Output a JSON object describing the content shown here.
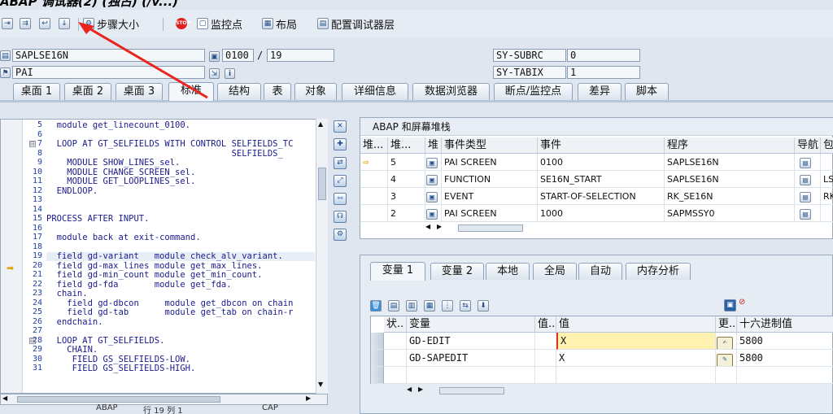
{
  "window": {
    "title": "ABAP 调试器(2) (独占) (/v...) "
  },
  "toolbar": {
    "step_size_label": "步骤大小",
    "breakpoints_label": "监控点",
    "layout_label": "布局",
    "config_label": "配置调试器层"
  },
  "info": {
    "program": "SAPLSE16N",
    "screen": "0100",
    "line": "19",
    "event": "PAI",
    "sy_subrc_label": "SY-SUBRC",
    "sy_subrc_value": "0",
    "sy_tabix_label": "SY-TABIX",
    "sy_tabix_value": "1"
  },
  "tabs": [
    "桌面 1",
    "桌面 2",
    "桌面 3",
    "标准",
    "结构",
    "表",
    "对象",
    "详细信息",
    "数据浏览器",
    "断点/监控点",
    "差异",
    "脚本"
  ],
  "editor": {
    "lines": [
      {
        "n": "5",
        "t": "  module get_linecount_0100."
      },
      {
        "n": "6",
        "t": ""
      },
      {
        "n": "7",
        "t": "  LOOP AT GT_SELFIELDS WITH CONTROL SELFIELDS_TC"
      },
      {
        "n": "8",
        "t": "                                    SELFIELDS_"
      },
      {
        "n": "9",
        "t": "    MODULE SHOW_LINES_sel."
      },
      {
        "n": "10",
        "t": "    MODULE CHANGE_SCREEN_sel."
      },
      {
        "n": "11",
        "t": "    MODULE GET_LOOPLINES_sel."
      },
      {
        "n": "12",
        "t": "  ENDLOOP."
      },
      {
        "n": "13",
        "t": ""
      },
      {
        "n": "14",
        "t": ""
      },
      {
        "n": "15",
        "t": "PROCESS AFTER INPUT."
      },
      {
        "n": "16",
        "t": ""
      },
      {
        "n": "17",
        "t": "  module back at exit-command."
      },
      {
        "n": "18",
        "t": ""
      },
      {
        "n": "19",
        "t": "  field gd-variant   module check_alv_variant."
      },
      {
        "n": "20",
        "t": "  field gd-max_lines module get_max_lines."
      },
      {
        "n": "21",
        "t": "  field gd-min_count module get_min_count."
      },
      {
        "n": "22",
        "t": "  field gd-fda       module get_fda."
      },
      {
        "n": "23",
        "t": "  chain."
      },
      {
        "n": "24",
        "t": "    field gd-dbcon     module get_dbcon on chain"
      },
      {
        "n": "25",
        "t": "    field gd-tab       module get_tab on chain-r"
      },
      {
        "n": "26",
        "t": "  endchain."
      },
      {
        "n": "27",
        "t": ""
      },
      {
        "n": "28",
        "t": "  LOOP AT GT_SELFIELDS."
      },
      {
        "n": "29",
        "t": "    CHAIN."
      },
      {
        "n": "30",
        "t": "     FIELD GS_SELFIELDS-LOW."
      },
      {
        "n": "31",
        "t": "     FIELD GS_SELFIELDS-HIGH."
      }
    ]
  },
  "stack": {
    "title": "ABAP 和屏幕堆栈",
    "headers": [
      "堆...",
      "堆...",
      "堆",
      "事件类型",
      "事件",
      "程序",
      "导航",
      "包"
    ],
    "rows": [
      {
        "level": "5",
        "type": "PAI SCREEN",
        "event": "0100",
        "program": "SAPLSE16N",
        "extra": ""
      },
      {
        "level": "4",
        "type": "FUNCTION",
        "event": "SE16N_START",
        "program": "SAPLSE16N",
        "extra": "LS"
      },
      {
        "level": "3",
        "type": "EVENT",
        "event": "START-OF-SELECTION",
        "program": "RK_SE16N",
        "extra": "RK"
      },
      {
        "level": "2",
        "type": "PAI SCREEN",
        "event": "1000",
        "program": "SAPMSSY0",
        "extra": ""
      }
    ]
  },
  "vars": {
    "tabs": [
      "变量 1",
      "变量 2",
      "本地",
      "全局",
      "自动",
      "内存分析"
    ],
    "headers": [
      "状..",
      "变量",
      "值..",
      "值",
      "更..",
      "十六进制值"
    ],
    "rows": [
      {
        "name": "GD-EDIT",
        "value": "X",
        "hex": "5800"
      },
      {
        "name": "GD-SAPEDIT",
        "value": "X",
        "hex": "5800"
      }
    ]
  },
  "status": {
    "left": "ABAP",
    "pos": "行 19 列 1",
    "right": "CAP"
  }
}
